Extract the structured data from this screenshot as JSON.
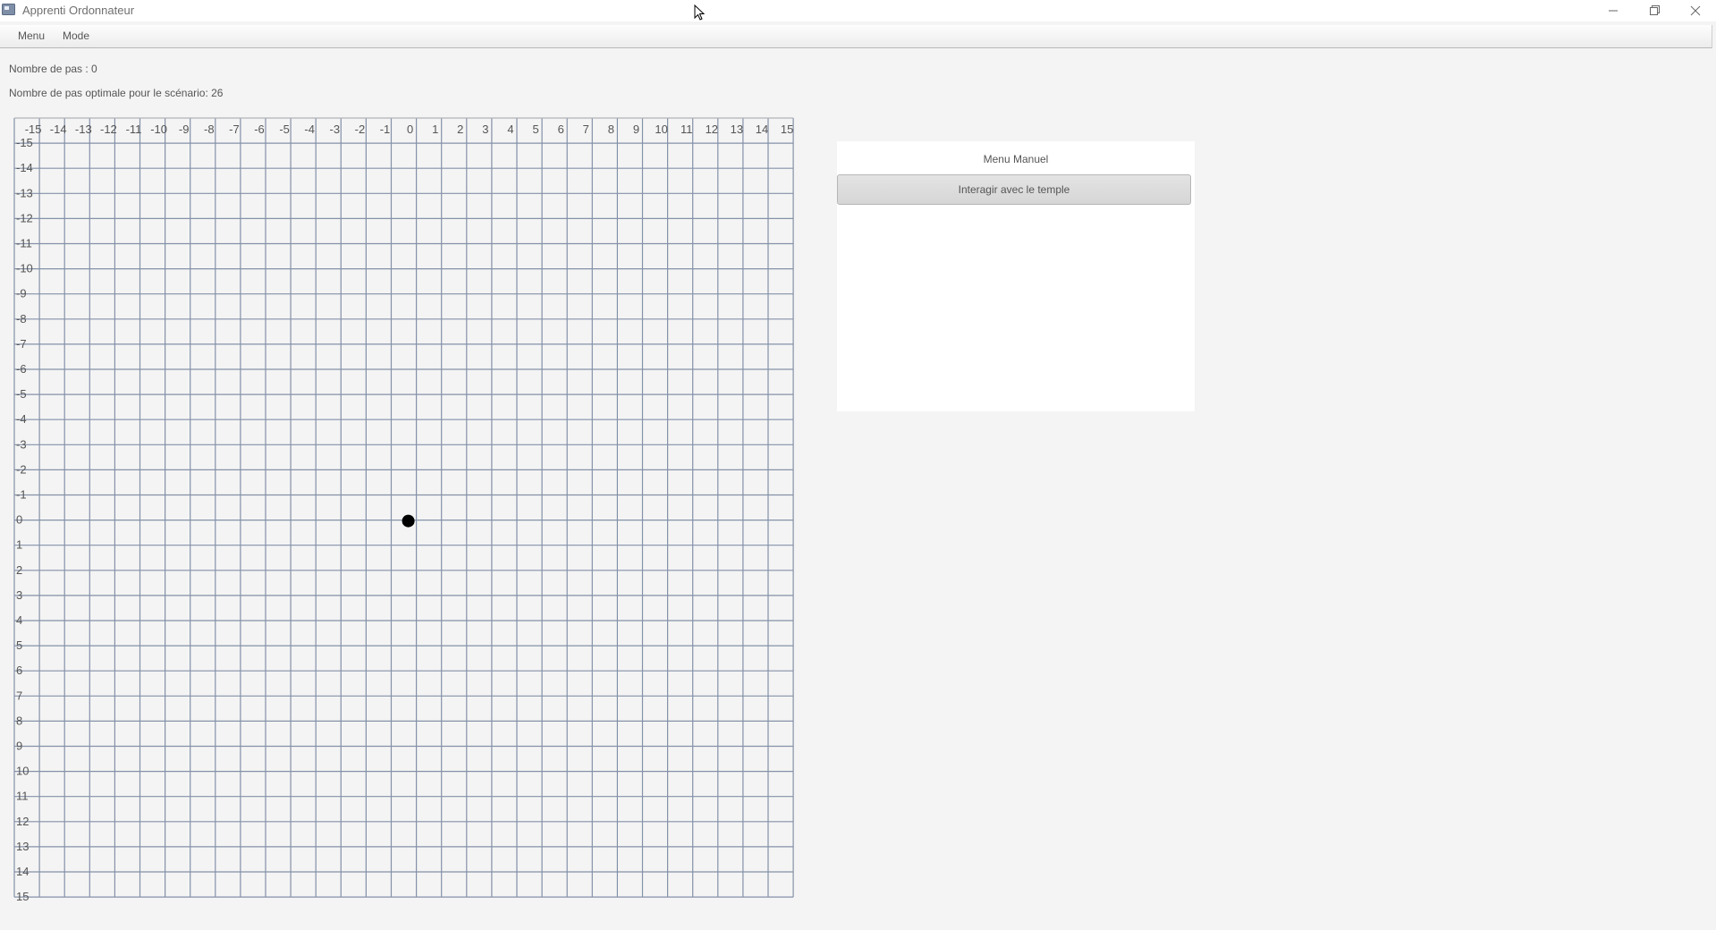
{
  "window": {
    "title": "Apprenti Ordonnateur",
    "minimize_icon": "minimize-icon",
    "maximize_icon": "maximize-icon",
    "close_icon": "close-icon"
  },
  "menubar": {
    "items": [
      {
        "label": "Menu"
      },
      {
        "label": "Mode"
      }
    ]
  },
  "info": {
    "steps": "Nombre de pas : 0",
    "optimal": "Nombre de pas optimale pour le scénario: 26"
  },
  "grid": {
    "x_ticks": [
      "-15",
      "-14",
      "-13",
      "-12",
      "-11",
      "-10",
      "-9",
      "-8",
      "-7",
      "-6",
      "-5",
      "-4",
      "-3",
      "-2",
      "-1",
      "0",
      "1",
      "2",
      "3",
      "4",
      "5",
      "6",
      "7",
      "8",
      "9",
      "10",
      "11",
      "12",
      "13",
      "14",
      "15"
    ],
    "y_ticks": [
      "-15",
      "-14",
      "-13",
      "-12",
      "-11",
      "-10",
      "-9",
      "-8",
      "-7",
      "-6",
      "-5",
      "-4",
      "-3",
      "-2",
      "-1",
      "0",
      "1",
      "2",
      "3",
      "4",
      "5",
      "6",
      "7",
      "8",
      "9",
      "10",
      "11",
      "12",
      "13",
      "14",
      "15"
    ],
    "player": {
      "x": 0,
      "y": 0
    },
    "line_color": "#8491a8",
    "player_color": "#000000"
  },
  "panel": {
    "title": "Menu Manuel",
    "button_label": "Interagir avec le temple"
  }
}
